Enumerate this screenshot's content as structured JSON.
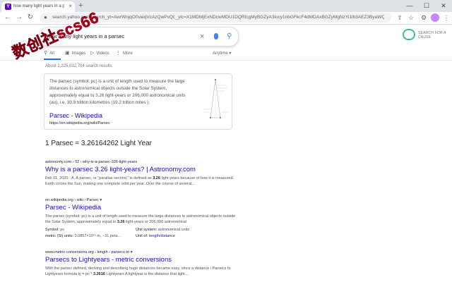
{
  "browser": {
    "tab_title": "how many light years in a parse",
    "tab_favicon_letter": "Y",
    "tab_close": "×",
    "new_tab": "+",
    "window_min": "—",
    "window_max": "☐",
    "window_close": "✕",
    "back": "←",
    "forward": "→",
    "reload": "↻",
    "url": "search.yahoo.com/search_yt=AwrWnjqO0vieqVcAzQwPxQt;_ylc=X1MDMjExNDcwMDU1DQRfcgMyBGZyA3locy1nbGFkcF4dMDAxBGZyMgNzYi1lb3AEZ3ByaWQDWTRacDVIaG..."
  },
  "search": {
    "query": "how many light years in a parsec",
    "clear_icon": "×",
    "search_icon": "⚲"
  },
  "charity": {
    "label": "SEARCH FOR A CAUSE"
  },
  "vertical_tabs": [
    {
      "label": "All",
      "icon": "⚲"
    },
    {
      "label": "Images",
      "icon": "▣"
    },
    {
      "label": "Videos",
      "icon": "▷"
    },
    {
      "label": "More",
      "icon": "⋮"
    }
  ],
  "anytime": "Anytime ▾",
  "stats": "About 1,225,032,704 search results",
  "snippet": {
    "text": "The parsec (symbol: pc) is a unit of length used to measure the large distances to astronomical objects outside the Solar System, approximately equal to 3.26 light-years or 206,000 astronomical units (au), i.e. 30.9 trillion kilometres (19.2 trillion miles ).",
    "title": "Parsec - Wikipedia",
    "url": "https://en.wikipedia.org/wiki/Parsec"
  },
  "answer": {
    "left_num": "1",
    "left_unit": "Parsec",
    "eq": "=",
    "right_num": "3.26164262",
    "right_unit": "Light Year"
  },
  "results": [
    {
      "cite": "astronomy.com › 02 › why-is-a-parsec-326-light-years",
      "title": "Why is a parsec 3.26 light-years? | Astronomy.com",
      "desc_pre": "Feb 01, 2020 · A. A parsec, or \"parallax second,\" is defined as ",
      "desc_bold": "3.26",
      "desc_post": " light-years because of how it is measured. Earth circles the Sun, making one complete orbit per year. Over the course of several..."
    },
    {
      "cite": "en.wikipedia.org › wiki › Parsec ▾",
      "title": "Parsec - Wikipedia",
      "desc_pre": "The parsec (symbol: pc) is a unit of length used to measure the large distances to astronomical objects outside the Solar System, approximately equal to ",
      "desc_bold": "3.26",
      "desc_post": " light-years or 206,000 astronomical",
      "facts": {
        "symbol_k": "Symbol:",
        "symbol_v": "pc",
        "system_k": "Unit system:",
        "system_v": "astronomical units",
        "metric_k": "metric (SI) units:",
        "metric_v": "3.0857×10¹⁶ m, ~31 peta...",
        "unitof_k": "Unit of:",
        "unitof_v": "length/distance"
      }
    },
    {
      "cite": "www.metric-conversions.org › length › parsecs-to ▾",
      "title": "Parsecs to Lightyears - metric conversions",
      "desc_pre": "With the parsec defined, deriving and describing huge distances became easy, since a distance i Parsecs to Lightyears formula ly = pc * ",
      "desc_bold": "3.2616",
      "desc_post": " Lightyears A lightyear is the distance that light..."
    }
  ],
  "watermark": "数创社scs66",
  "colors": {
    "link": "#1a0dab",
    "accent": "#1a73e8",
    "watermark": "#b3001b",
    "charity_logo": "#3cba9f"
  }
}
